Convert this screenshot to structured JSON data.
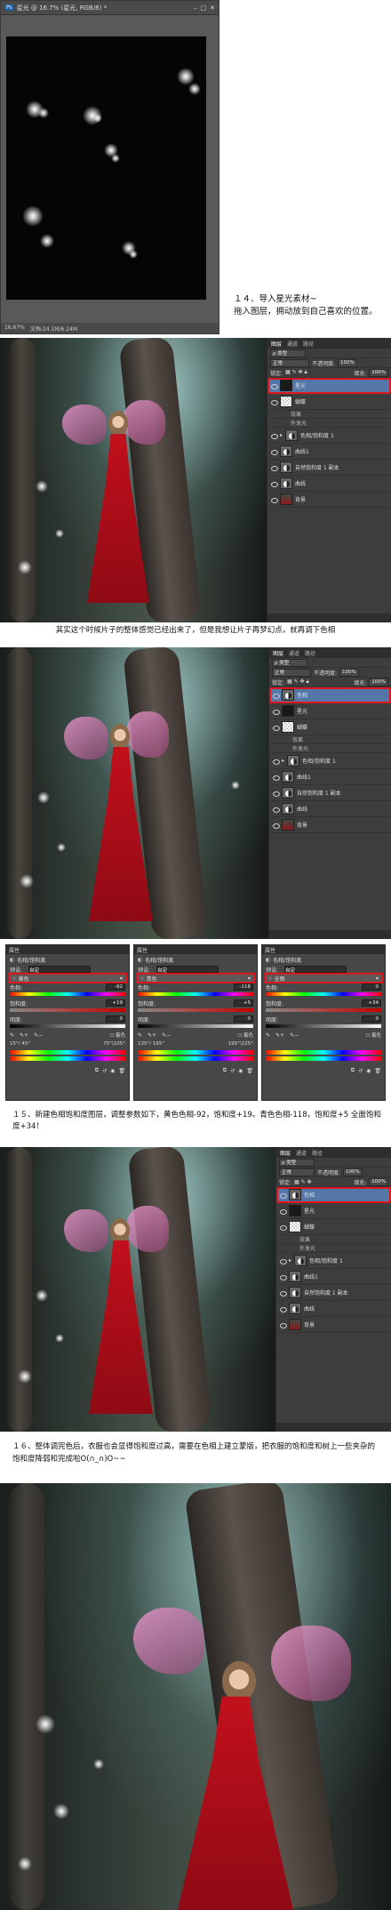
{
  "doc_window": {
    "title": "星光 @ 16.7% (星光, RGB/8) *",
    "zoom": "16.67%",
    "doc_info": "文档:24.1M/6.24M"
  },
  "captions": {
    "step14_line1": "１４、导入星光素材~",
    "step14_line2": "拖入图层，拥动放到自己喜欢的位置。",
    "between": "其实这个时候片子的整体感觉已经出来了，但是我想让片子再梦幻点，就再调下色相",
    "step15": "１５、新建色相饱和度图层，调整参数如下，黄色色相-92，饱和度+19。青色色相-118，饱和度+5 全面饱和度+34！",
    "step16": "１６、整体调完色后，衣服也会显得饱和度过高，需要在色相上建立蒙版，把衣服的饱和度和树上一些夹杂的饱和度降弱和完成啦O(∩_∩)O~~"
  },
  "layers_panel_1": {
    "tabs": [
      "图层",
      "通道",
      "路径"
    ],
    "kind": "ρ 类型",
    "blend": "正常",
    "opacity_label": "不透明度:",
    "opacity": "100%",
    "lock_label": "锁定:",
    "fill_label": "填充:",
    "fill": "100%",
    "layers": [
      {
        "name": "星光",
        "selected": true,
        "thumb": "dark"
      },
      {
        "name": "蝴蝶",
        "selected": false,
        "thumb": "trans"
      },
      {
        "name": "效果",
        "sub": true
      },
      {
        "name": "外发光",
        "sub": true
      },
      {
        "name": "色相/饱和度 1",
        "selected": false,
        "thumb": "adj",
        "group": true
      },
      {
        "name": "曲线1",
        "selected": false,
        "thumb": "adj"
      },
      {
        "name": "自然饱和度 1 副本",
        "selected": false,
        "thumb": "adj"
      },
      {
        "name": "曲线",
        "selected": false,
        "thumb": "adj"
      },
      {
        "name": "背景",
        "selected": false,
        "thumb": "photo"
      }
    ]
  },
  "layers_panel_2": {
    "tabs": [
      "图层",
      "通道",
      "路径"
    ],
    "kind": "ρ 类型",
    "blend": "正常",
    "opacity_label": "不透明度:",
    "opacity": "100%",
    "lock_label": "锁定:",
    "fill_label": "填充:",
    "fill": "100%",
    "layers": [
      {
        "name": "色相",
        "selected": true,
        "thumb": "adj"
      },
      {
        "name": "星光",
        "selected": false,
        "thumb": "dark"
      },
      {
        "name": "蝴蝶",
        "selected": false,
        "thumb": "trans"
      },
      {
        "name": "效果",
        "sub": true
      },
      {
        "name": "外发光",
        "sub": true
      },
      {
        "name": "色相/饱和度 1",
        "selected": false,
        "thumb": "adj",
        "group": true
      },
      {
        "name": "曲线1",
        "selected": false,
        "thumb": "adj"
      },
      {
        "name": "自然饱和度 1 副本",
        "selected": false,
        "thumb": "adj"
      },
      {
        "name": "曲线",
        "selected": false,
        "thumb": "adj"
      },
      {
        "name": "背景",
        "selected": false,
        "thumb": "photo"
      }
    ]
  },
  "layers_panel_3": {
    "tabs": [
      "图层",
      "通道",
      "路径"
    ],
    "kind": "ρ 类型",
    "blend": "正常",
    "opacity_label": "不透明度:",
    "opacity": "100%",
    "lock_label": "锁定:",
    "fill_label": "填充:",
    "fill": "100%",
    "layers": [
      {
        "name": "色相",
        "selected": true,
        "thumb": "adj"
      },
      {
        "name": "星光",
        "selected": false,
        "thumb": "dark"
      },
      {
        "name": "蝴蝶",
        "selected": false,
        "thumb": "trans"
      },
      {
        "name": "效果",
        "sub": true
      },
      {
        "name": "外发光",
        "sub": true
      },
      {
        "name": "色相/饱和度 1",
        "selected": false,
        "thumb": "adj",
        "group": true
      },
      {
        "name": "曲线1",
        "selected": false,
        "thumb": "adj"
      },
      {
        "name": "自然饱和度 1 副本",
        "selected": false,
        "thumb": "adj"
      },
      {
        "name": "曲线",
        "selected": false,
        "thumb": "adj"
      },
      {
        "name": "背景",
        "selected": false,
        "thumb": "photo"
      }
    ]
  },
  "hue_sat_panels": [
    {
      "title": "属性",
      "sub": "色相/饱和度",
      "preset_label": "预设:",
      "preset": "自定",
      "channel": "黄色",
      "hue_label": "色相:",
      "hue": "-92",
      "sat_label": "饱和度:",
      "sat": "+19",
      "light_label": "明度:",
      "light": "0",
      "range": "15°/ 45°",
      "range2": "75°\\105°"
    },
    {
      "title": "属性",
      "sub": "色相/饱和度",
      "preset_label": "预设:",
      "preset": "自定",
      "channel": "青色",
      "hue_label": "色相:",
      "hue": "-118",
      "sat_label": "饱和度:",
      "sat": "+5",
      "light_label": "明度:",
      "light": "0",
      "range": "135°/ 165°",
      "range2": "195°\\225°"
    },
    {
      "title": "属性",
      "sub": "色相/饱和度",
      "preset_label": "预设:",
      "preset": "自定",
      "channel": "全图",
      "hue_label": "色相:",
      "hue": "0",
      "sat_label": "饱和度:",
      "sat": "+34",
      "light_label": "明度:",
      "light": "0",
      "range": "",
      "range2": ""
    }
  ]
}
